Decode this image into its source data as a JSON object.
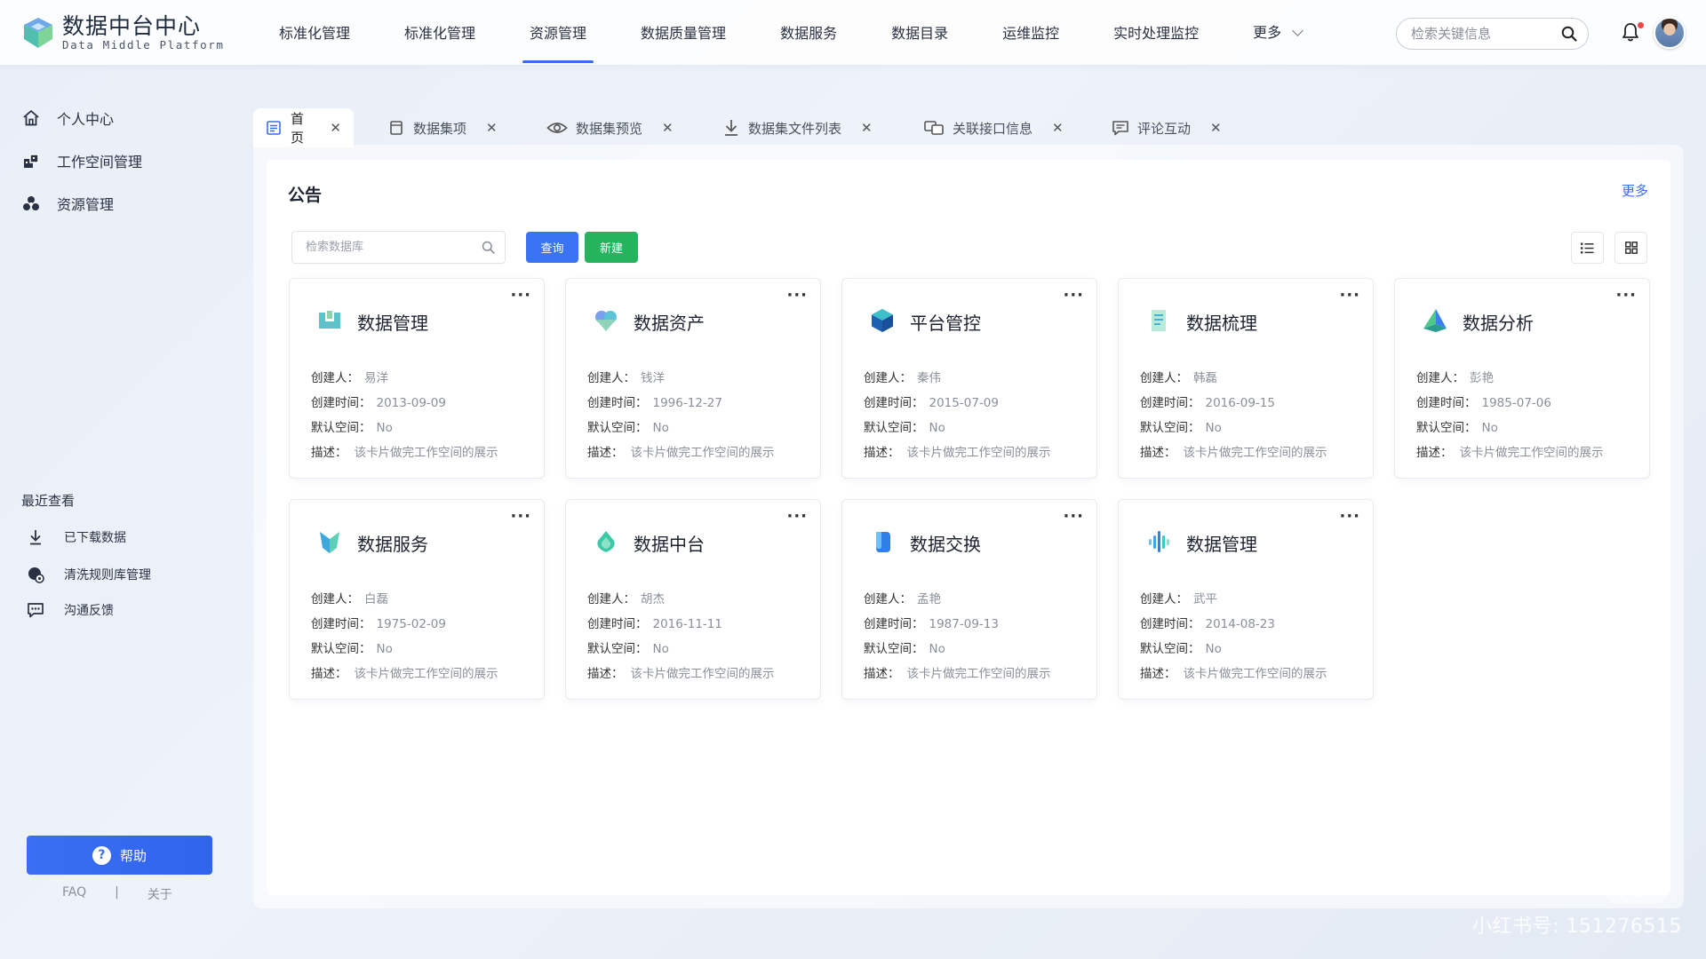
{
  "brand": {
    "title": "数据中台中心",
    "subtitle": "Data Middle Platform"
  },
  "topnav": {
    "items": [
      {
        "label": "标准化管理",
        "active": false
      },
      {
        "label": "标准化管理",
        "active": false
      },
      {
        "label": "资源管理",
        "active": true
      },
      {
        "label": "数据质量管理",
        "active": false
      },
      {
        "label": "数据服务",
        "active": false
      },
      {
        "label": "数据目录",
        "active": false
      },
      {
        "label": "运维监控",
        "active": false
      },
      {
        "label": "实时处理监控",
        "active": false
      }
    ],
    "more_label": "更多",
    "search_placeholder": "检索关键信息"
  },
  "sidebar": {
    "items": [
      {
        "label": "个人中心",
        "icon": "home-icon"
      },
      {
        "label": "工作空间管理",
        "icon": "workspace-icon"
      },
      {
        "label": "资源管理",
        "icon": "resource-icon"
      }
    ],
    "recent_title": "最近查看",
    "recent_items": [
      {
        "label": "已下载数据",
        "icon": "download-icon"
      },
      {
        "label": "清洗规则库管理",
        "icon": "rules-icon"
      },
      {
        "label": "沟通反馈",
        "icon": "feedback-icon"
      }
    ],
    "help_label": "帮助",
    "footer": {
      "faq": "FAQ",
      "separator": "|",
      "about": "关于"
    }
  },
  "tabs": [
    {
      "label": "首页",
      "icon": "home-doc-icon",
      "active": true
    },
    {
      "label": "数据集项",
      "icon": "dataset-icon",
      "active": false
    },
    {
      "label": "数据集预览",
      "icon": "eye-icon",
      "active": false
    },
    {
      "label": "数据集文件列表",
      "icon": "download-icon",
      "active": false
    },
    {
      "label": "关联接口信息",
      "icon": "link-icon",
      "active": false
    },
    {
      "label": "评论互动",
      "icon": "comment-icon",
      "active": false
    }
  ],
  "main": {
    "title": "公告",
    "more_label": "更多",
    "search_placeholder": "检索数据库",
    "query_label": "查询",
    "new_label": "新建",
    "labels": {
      "creator": "创建人：",
      "created": "创建时间：",
      "default_space": "默认空间：",
      "desc": "描述："
    }
  },
  "cards": [
    {
      "title": "数据管理",
      "icon": "data-management-icon",
      "creator": "易洋",
      "date": "2013-09-09",
      "default_space": "No",
      "desc": "该卡片做完工作空间的展示"
    },
    {
      "title": "数据资产",
      "icon": "data-asset-icon",
      "creator": "钱洋",
      "date": "1996-12-27",
      "default_space": "No",
      "desc": "该卡片做完工作空间的展示"
    },
    {
      "title": "平台管控",
      "icon": "platform-control-icon",
      "creator": "秦伟",
      "date": "2015-07-09",
      "default_space": "No",
      "desc": "该卡片做完工作空间的展示"
    },
    {
      "title": "数据梳理",
      "icon": "data-sort-icon",
      "creator": "韩磊",
      "date": "2016-09-15",
      "default_space": "No",
      "desc": "该卡片做完工作空间的展示"
    },
    {
      "title": "数据分析",
      "icon": "data-analysis-icon",
      "creator": "彭艳",
      "date": "1985-07-06",
      "default_space": "No",
      "desc": "该卡片做完工作空间的展示"
    },
    {
      "title": "数据服务",
      "icon": "data-service-icon",
      "creator": "白磊",
      "date": "1975-02-09",
      "default_space": "No",
      "desc": "该卡片做完工作空间的展示"
    },
    {
      "title": "数据中台",
      "icon": "data-platform-icon",
      "creator": "胡杰",
      "date": "2016-11-11",
      "default_space": "No",
      "desc": "该卡片做完工作空间的展示"
    },
    {
      "title": "数据交换",
      "icon": "data-exchange-icon",
      "creator": "孟艳",
      "date": "1987-09-13",
      "default_space": "No",
      "desc": "该卡片做完工作空间的展示"
    },
    {
      "title": "数据管理",
      "icon": "data-manage-wave-icon",
      "creator": "武平",
      "date": "2014-08-23",
      "default_space": "No",
      "desc": "该卡片做完工作空间的展示"
    }
  ],
  "watermark": {
    "text": "小红书号: 151276515",
    "badge": "小红书"
  },
  "colors": {
    "accent": "#3a6cf0",
    "new_button": "#24b45e",
    "help_button": "#3b6ff2"
  }
}
